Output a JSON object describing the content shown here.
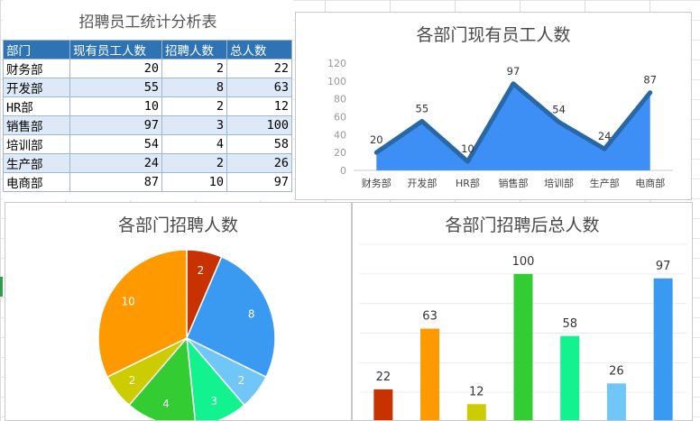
{
  "table": {
    "title": "招聘员工统计分析表",
    "headers": [
      "部门",
      "现有员工人数",
      "招聘人数",
      "总人数"
    ],
    "rows": [
      [
        "财务部",
        "20",
        "2",
        "22"
      ],
      [
        "开发部",
        "55",
        "8",
        "63"
      ],
      [
        "HR部",
        "10",
        "2",
        "12"
      ],
      [
        "销售部",
        "97",
        "3",
        "100"
      ],
      [
        "培训部",
        "54",
        "4",
        "58"
      ],
      [
        "生产部",
        "24",
        "2",
        "26"
      ],
      [
        "电商部",
        "87",
        "10",
        "97"
      ]
    ]
  },
  "chart_data": [
    {
      "type": "area",
      "title": "各部门现有员工人数",
      "categories": [
        "财务部",
        "开发部",
        "HR部",
        "销售部",
        "培训部",
        "生产部",
        "电商部"
      ],
      "values": [
        20,
        55,
        10,
        97,
        54,
        24,
        87
      ],
      "ylim": [
        0,
        120
      ],
      "yticks": [
        0,
        20,
        40,
        60,
        80,
        100,
        120
      ],
      "grid": false,
      "colors": {
        "fill": "#3d8ef5",
        "line": "#2868a6"
      }
    },
    {
      "type": "pie",
      "title": "各部门招聘人数",
      "values": [
        2,
        8,
        2,
        3,
        4,
        2,
        10
      ],
      "colors": [
        "#c73200",
        "#3a99f0",
        "#6fc6f7",
        "#12f28e",
        "#33cc33",
        "#cccc00",
        "#ff9900"
      ]
    },
    {
      "type": "bar",
      "title": "各部门招聘后总人数",
      "values": [
        22,
        63,
        12,
        100,
        58,
        26,
        97
      ],
      "ylim": [
        0,
        120
      ],
      "grid": true,
      "colors": [
        "#c73200",
        "#ff9900",
        "#cccc00",
        "#33cc33",
        "#12f28e",
        "#6fc6f7",
        "#3a99f0"
      ]
    }
  ]
}
